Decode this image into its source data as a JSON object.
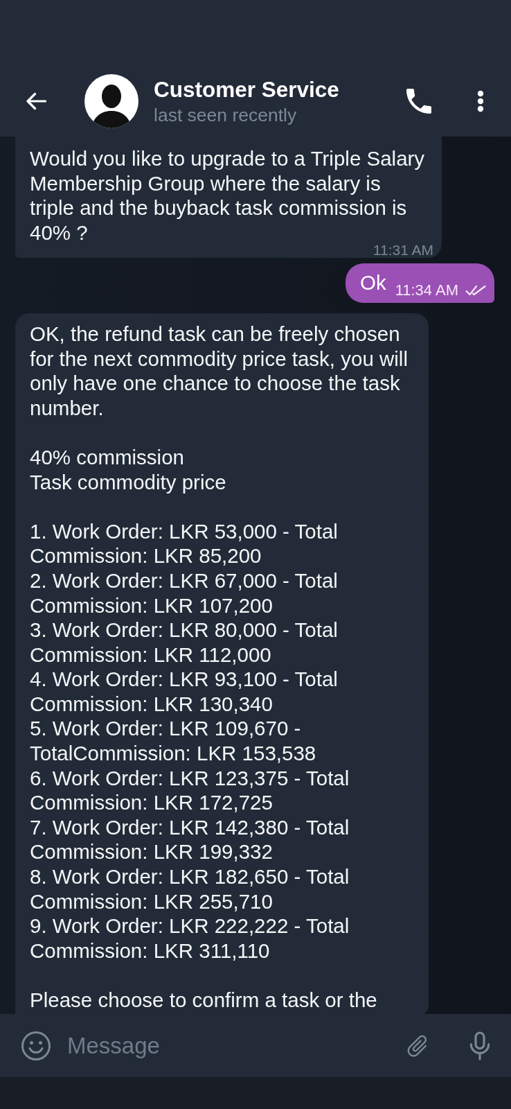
{
  "header": {
    "title": "Customer Service",
    "subtitle": "last seen recently"
  },
  "messages": [
    {
      "kind": "incoming",
      "text": "Would you like to upgrade to a Triple Salary Membership Group where the salary is triple and the buyback task commission is 40% ?",
      "time": "11:31 AM"
    },
    {
      "kind": "outgoing",
      "text": "Ok",
      "time": "11:34 AM",
      "read": true
    },
    {
      "kind": "incoming",
      "text": "OK, the refund task can be freely chosen for the next commodity price task, you will only have one chance to choose the task number.\n\n40% commission\nTask commodity price\n\n1. Work Order: LKR 53,000 - Total Commission: LKR 85,200\n2. Work Order: LKR 67,000 - Total Commission: LKR 107,200\n3. Work Order: LKR 80,000 - Total Commission: LKR 112,000\n4. Work Order: LKR 93,100 - Total Commission: LKR 130,340\n5. Work Order: LKR 109,670 - TotalCommission: LKR 153,538\n6. Work Order: LKR 123,375 - Total Commission: LKR 172,725\n7. Work Order: LKR 142,380 - Total Commission: LKR 199,332\n8. Work Order: LKR 182,650 - Total Commission: LKR 255,710\n9. Work Order: LKR 222,222 - Total Commission: LKR 311,110\n\nPlease choose to confirm a task or the"
    }
  ],
  "composer": {
    "placeholder": "Message"
  }
}
